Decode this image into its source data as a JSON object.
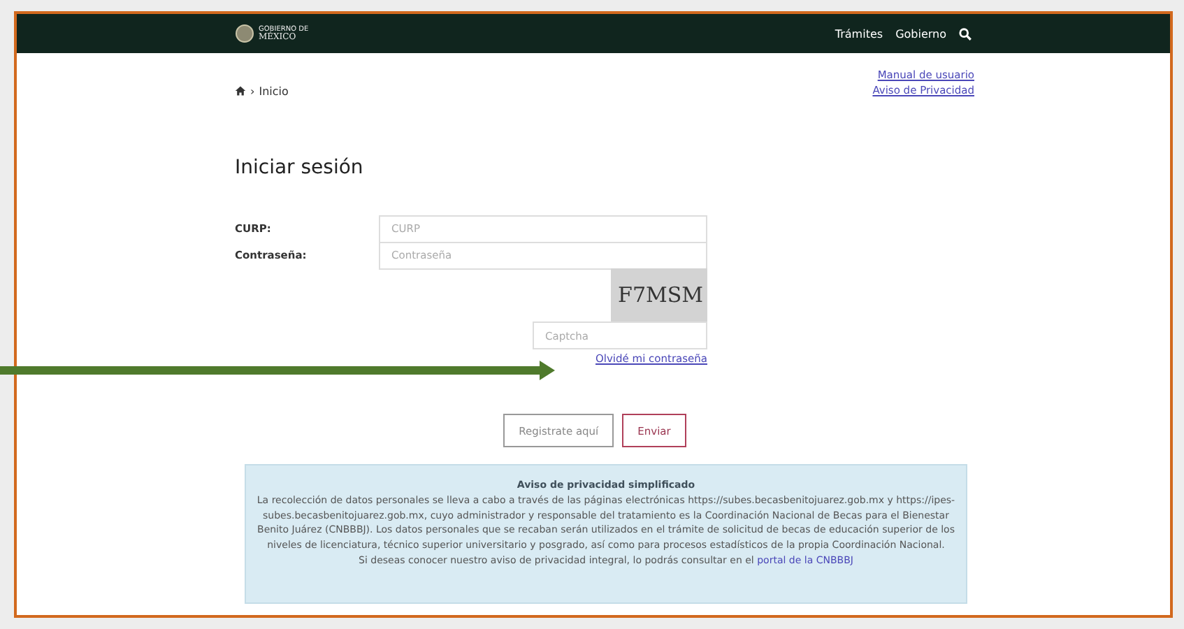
{
  "header": {
    "logo_small": "GOBIERNO DE",
    "logo_big": "MÉXICO",
    "nav": [
      "Trámites",
      "Gobierno"
    ]
  },
  "breadcrumb_separator": "›",
  "breadcrumb": "Inicio",
  "top_links": [
    "Manual de usuario",
    "Aviso de Privacidad"
  ],
  "title": "Iniciar sesión",
  "form": {
    "fields": [
      {
        "label": "CURP:",
        "placeholder": "CURP"
      },
      {
        "label": "Contraseña:",
        "placeholder": "Contraseña"
      }
    ],
    "captcha_text": "F7MSM",
    "captcha_placeholder": "Captcha",
    "forgot_link": "Olvidé mi contraseña"
  },
  "buttons": [
    "Registrate aquí",
    "Enviar"
  ],
  "privacy": {
    "title": "Aviso de privacidad simplificado",
    "body": "La recolección de datos personales se lleva a cabo a través de las páginas electrónicas https://subes.becasbenitojuarez.gob.mx y https://ipes-subes.becasbenitojuarez.gob.mx, cuyo administrador y responsable del tratamiento es la Coordinación Nacional de Becas para el Bienestar Benito Juárez (CNBBBJ). Los datos personales que se recaban serán utilizados en el trámite de solicitud de becas de educación superior de los niveles de licenciatura, técnico superior universitario y posgrado, así como para procesos estadísticos de la propia Coordinación Nacional.",
    "more": "Si deseas conocer nuestro aviso de privacidad integral, lo podrás consultar en el",
    "more_link": "portal de la CNBBBJ"
  }
}
